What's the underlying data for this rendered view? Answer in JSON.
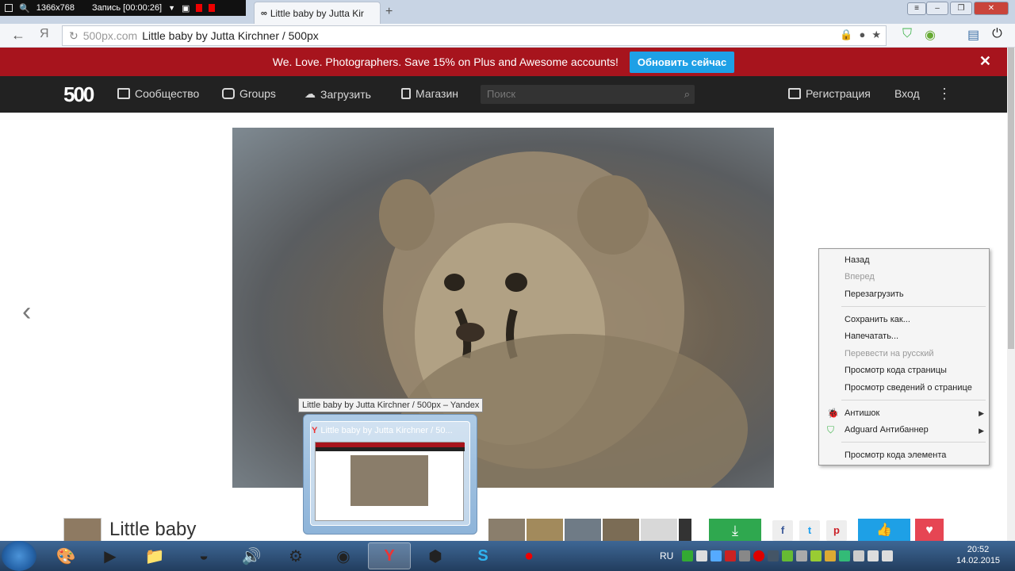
{
  "recorder": {
    "resolution": "1366x768",
    "status": "Запись [00:00:26]"
  },
  "browser": {
    "tab_title": "Little baby by Jutta Kir",
    "new_tab": "+",
    "address_domain": "500px.com",
    "address_title": "Little baby by Jutta Kirchner / 500px",
    "yandex_letter": "Я"
  },
  "promo": {
    "text": "We. Love. Photographers. Save 15% on Plus and Awesome accounts!",
    "button": "Обновить сейчас",
    "close": "✕"
  },
  "site_nav": {
    "logo": "500",
    "items": [
      {
        "label": "Сообщество"
      },
      {
        "label": "Groups"
      },
      {
        "label": "Загрузить"
      },
      {
        "label": "Магазин"
      }
    ],
    "search_placeholder": "Поиск",
    "register": "Регистрация",
    "login": "Вход"
  },
  "photo": {
    "title": "Little baby",
    "prev": "‹"
  },
  "taskbar_preview": {
    "tooltip": "Little baby by Jutta Kirchner / 500px – Yandex",
    "window_title": "Little baby by Jutta Kirchner / 50..."
  },
  "context_menu": {
    "items": [
      {
        "label": "Назад",
        "disabled": false
      },
      {
        "label": "Вперед",
        "disabled": true
      },
      {
        "label": "Перезагрузить",
        "disabled": false
      },
      {
        "label": "Сохранить как...",
        "disabled": false
      },
      {
        "label": "Напечатать...",
        "disabled": false
      },
      {
        "label": "Перевести на русский",
        "disabled": true
      },
      {
        "label": "Просмотр кода страницы",
        "disabled": false
      },
      {
        "label": "Просмотр сведений о странице",
        "disabled": false
      },
      {
        "label": "Антишок",
        "disabled": false,
        "submenu": true
      },
      {
        "label": "Adguard Антибаннер",
        "disabled": false,
        "submenu": true
      },
      {
        "label": "Просмотр кода элемента",
        "disabled": false
      }
    ]
  },
  "tray": {
    "lang": "RU",
    "time": "20:52",
    "date": "14.02.2015"
  },
  "colors": {
    "promo_bg": "#a7141d",
    "accent_blue": "#1ea0e6",
    "nav_bg": "#222222",
    "download_green": "#2fa84f",
    "fav_red": "#e64553"
  }
}
